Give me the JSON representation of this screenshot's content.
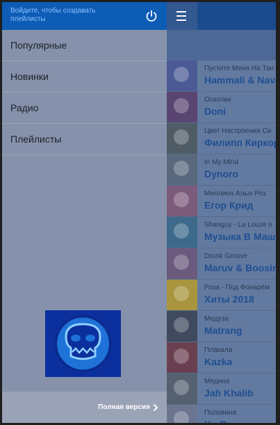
{
  "drawer": {
    "login_prompt": "Войдите, чтобы создавать плейлисты",
    "menu": [
      {
        "label": "Популярные"
      },
      {
        "label": "Новинки"
      },
      {
        "label": "Радио"
      },
      {
        "label": "Плейлисты"
      }
    ],
    "footer_label": "Полная версия"
  },
  "tracks": [
    {
      "title": "Пустите Меня На Тан",
      "artist": "Hammali & Nava",
      "cover_color": "#4b5a95"
    },
    {
      "title": "Осколки",
      "artist": "Doni",
      "cover_color": "#5a4572"
    },
    {
      "title": "Цвет Настроения Си",
      "artist": "Филипп Киркор",
      "cover_color": "#4f5c66"
    },
    {
      "title": "In My Mind",
      "artist": "Dynoro",
      "cover_color": "#59687c"
    },
    {
      "title": "Миллион Алых Роз",
      "artist": "Егор Крид",
      "cover_color": "#7c5a7a"
    },
    {
      "title": "Shanguy - La Louze n",
      "artist": "Музыка В Маш",
      "cover_color": "#3d6a8a"
    },
    {
      "title": "Drunk Groove",
      "artist": "Maruv & Boosin",
      "cover_color": "#6b5a7e"
    },
    {
      "title": "Роза - Под Фонарём",
      "artist": "Хиты 2018",
      "cover_color": "#a8953e"
    },
    {
      "title": "Медуза",
      "artist": "Matrang",
      "cover_color": "#3f4a5e"
    },
    {
      "title": "Плакала",
      "artist": "Kazka",
      "cover_color": "#6a4050"
    },
    {
      "title": "Медина",
      "artist": "Jah Khalib",
      "cover_color": "#556070"
    },
    {
      "title": "Половина",
      "artist": "Ka-Re",
      "cover_color": "#6c7590"
    }
  ]
}
